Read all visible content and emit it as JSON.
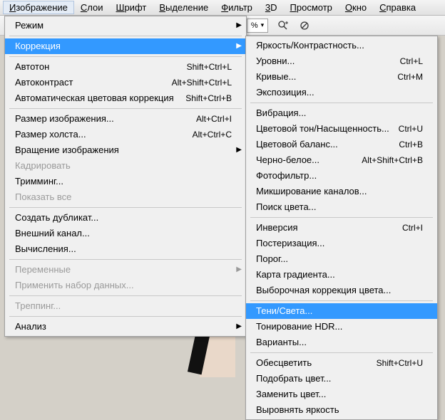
{
  "menubar": {
    "items": [
      {
        "label": "Изображение",
        "u": "И",
        "active": true
      },
      {
        "label": "Слои",
        "u": "С"
      },
      {
        "label": "Шрифт",
        "u": "Ш"
      },
      {
        "label": "Выделение",
        "u": "В"
      },
      {
        "label": "Фильтр",
        "u": "Ф"
      },
      {
        "label": "3D",
        "u": "3"
      },
      {
        "label": "Просмотр",
        "u": "П"
      },
      {
        "label": "Окно",
        "u": "О"
      },
      {
        "label": "Справка",
        "u": "С"
      }
    ]
  },
  "toolbar": {
    "percent": "%",
    "dropdown_arrow": "▾"
  },
  "main_menu": {
    "g1": [
      {
        "label": "Режим",
        "arrow": true
      }
    ],
    "g2": [
      {
        "label": "Коррекция",
        "arrow": true,
        "highlight": true
      }
    ],
    "g3": [
      {
        "label": "Автотон",
        "shortcut": "Shift+Ctrl+L"
      },
      {
        "label": "Автоконтраст",
        "shortcut": "Alt+Shift+Ctrl+L"
      },
      {
        "label": "Автоматическая цветовая коррекция",
        "shortcut": "Shift+Ctrl+B"
      }
    ],
    "g4": [
      {
        "label": "Размер изображения...",
        "shortcut": "Alt+Ctrl+I"
      },
      {
        "label": "Размер холста...",
        "shortcut": "Alt+Ctrl+C"
      },
      {
        "label": "Вращение изображения",
        "arrow": true
      },
      {
        "label": "Кадрировать",
        "disabled": true
      },
      {
        "label": "Тримминг..."
      },
      {
        "label": "Показать все",
        "disabled": true
      }
    ],
    "g5": [
      {
        "label": "Создать дубликат..."
      },
      {
        "label": "Внешний канал..."
      },
      {
        "label": "Вычисления..."
      }
    ],
    "g6": [
      {
        "label": "Переменные",
        "arrow": true,
        "disabled": true
      },
      {
        "label": "Применить набор данных...",
        "disabled": true
      }
    ],
    "g7": [
      {
        "label": "Треппинг...",
        "disabled": true
      }
    ],
    "g8": [
      {
        "label": "Анализ",
        "arrow": true
      }
    ]
  },
  "sub_menu": {
    "g1": [
      {
        "label": "Яркость/Контрастность..."
      },
      {
        "label": "Уровни...",
        "shortcut": "Ctrl+L"
      },
      {
        "label": "Кривые...",
        "shortcut": "Ctrl+M"
      },
      {
        "label": "Экспозиция..."
      }
    ],
    "g2": [
      {
        "label": "Вибрация..."
      },
      {
        "label": "Цветовой тон/Насыщенность...",
        "shortcut": "Ctrl+U"
      },
      {
        "label": "Цветовой баланс...",
        "shortcut": "Ctrl+B"
      },
      {
        "label": "Черно-белое...",
        "shortcut": "Alt+Shift+Ctrl+B"
      },
      {
        "label": "Фотофильтр..."
      },
      {
        "label": "Микширование каналов..."
      },
      {
        "label": "Поиск цвета..."
      }
    ],
    "g3": [
      {
        "label": "Инверсия",
        "shortcut": "Ctrl+I"
      },
      {
        "label": "Постеризация..."
      },
      {
        "label": "Порог..."
      },
      {
        "label": "Карта градиента..."
      },
      {
        "label": "Выборочная коррекция цвета..."
      }
    ],
    "g4": [
      {
        "label": "Тени/Света...",
        "highlight": true
      },
      {
        "label": "Тонирование HDR..."
      },
      {
        "label": "Варианты..."
      }
    ],
    "g5": [
      {
        "label": "Обесцветить",
        "shortcut": "Shift+Ctrl+U"
      },
      {
        "label": "Подобрать цвет..."
      },
      {
        "label": "Заменить цвет..."
      },
      {
        "label": "Выровнять яркость"
      }
    ]
  }
}
